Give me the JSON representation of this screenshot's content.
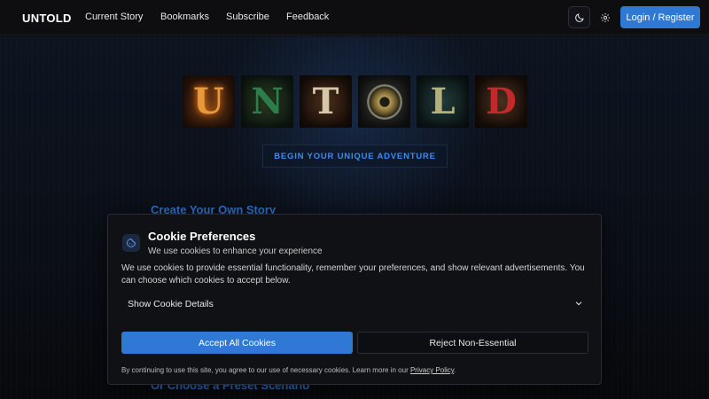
{
  "nav": {
    "brand": "UNTOLD",
    "links": [
      "Current Story",
      "Bookmarks",
      "Subscribe",
      "Feedback"
    ],
    "login_label": "Login / Register",
    "theme_icon": "moon-icon",
    "settings_icon": "gear-icon"
  },
  "hero": {
    "logo_letters": [
      "U",
      "N",
      "T",
      "O",
      "L",
      "D"
    ],
    "begin_label": "BEGIN YOUR UNIQUE ADVENTURE",
    "create_title": "Create Your Own Story",
    "preset_title": "Or Choose a Preset Scenario"
  },
  "cookie": {
    "icon": "cookie-icon",
    "title": "Cookie Preferences",
    "subtitle": "We use cookies to enhance your experience",
    "body": "We use cookies to provide essential functionality, remember your preferences, and show relevant advertisements. You can choose which cookies to accept below.",
    "details_label": "Show Cookie Details",
    "accept_label": "Accept All Cookies",
    "reject_label": "Reject Non-Essential",
    "footer_text": "By continuing to use this site, you agree to our use of necessary cookies. Learn more in our ",
    "policy_link": "Privacy Policy",
    "footer_end": "."
  },
  "colors": {
    "accent": "#2f78d4",
    "heading_blue": "#2f74d0",
    "background": "#0b0b0d"
  }
}
